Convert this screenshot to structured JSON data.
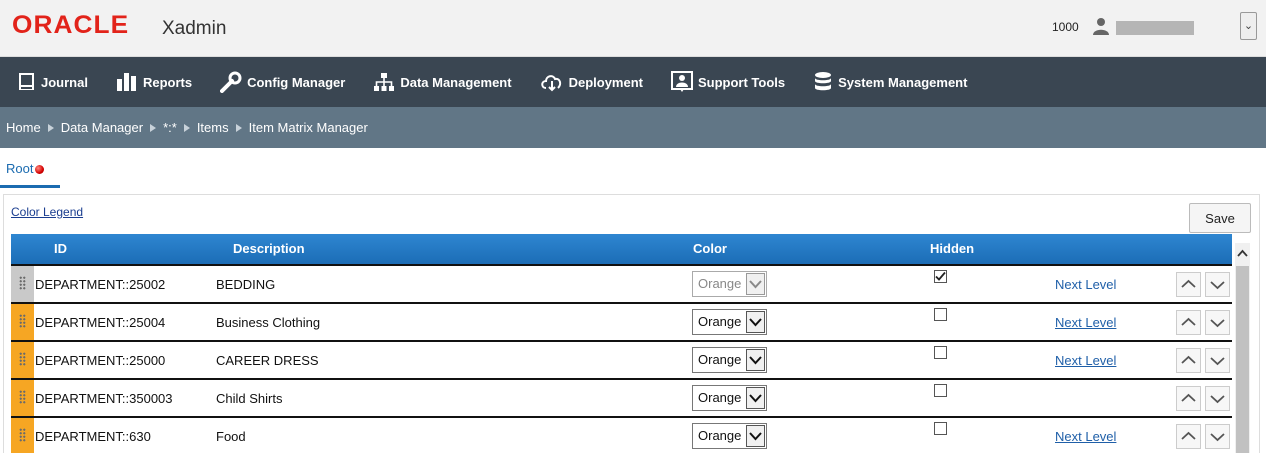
{
  "header": {
    "brand": "ORACLE",
    "app_name": "Xadmin",
    "store_id": "1000"
  },
  "nav": [
    {
      "label": "Journal",
      "icon": "journal-icon"
    },
    {
      "label": "Reports",
      "icon": "bar-chart-icon"
    },
    {
      "label": "Config Manager",
      "icon": "wrench-icon"
    },
    {
      "label": "Data Management",
      "icon": "hierarchy-icon"
    },
    {
      "label": "Deployment",
      "icon": "cloud-download-icon"
    },
    {
      "label": "Support Tools",
      "icon": "support-user-icon"
    },
    {
      "label": "System Management",
      "icon": "database-icon"
    }
  ],
  "breadcrumb": [
    "Home",
    "Data Manager",
    "*:*",
    "Items",
    "Item Matrix Manager"
  ],
  "tab": {
    "label": "Root"
  },
  "panel": {
    "color_legend_label": "Color Legend",
    "save_label": "Save"
  },
  "grid": {
    "columns": [
      "ID",
      "Description",
      "Color",
      "Hidden"
    ],
    "rows": [
      {
        "id": "DEPARTMENT::25002",
        "description": "BEDDING",
        "color": "Orange",
        "color_disabled": true,
        "hidden": true,
        "next_level": "Next Level",
        "handle_color": "#c9c9c9"
      },
      {
        "id": "DEPARTMENT::25004",
        "description": "Business Clothing",
        "color": "Orange",
        "color_disabled": false,
        "hidden": false,
        "next_level": "Next Level",
        "handle_color": "#f6a623"
      },
      {
        "id": "DEPARTMENT::25000",
        "description": "CAREER DRESS",
        "color": "Orange",
        "color_disabled": false,
        "hidden": false,
        "next_level": "Next Level",
        "handle_color": "#f6a623"
      },
      {
        "id": "DEPARTMENT::350003",
        "description": "Child Shirts",
        "color": "Orange",
        "color_disabled": false,
        "hidden": false,
        "next_level": "",
        "handle_color": "#f6a623"
      },
      {
        "id": "DEPARTMENT::630",
        "description": "Food",
        "color": "Orange",
        "color_disabled": false,
        "hidden": false,
        "next_level": "Next Level",
        "handle_color": "#f6a623"
      }
    ]
  },
  "colors": {
    "brand_red": "#e2231a",
    "nav_bg": "#3a4652",
    "breadcrumb_bg": "#617686",
    "grid_header": "#1c6db6",
    "handle_orange": "#f6a623"
  }
}
